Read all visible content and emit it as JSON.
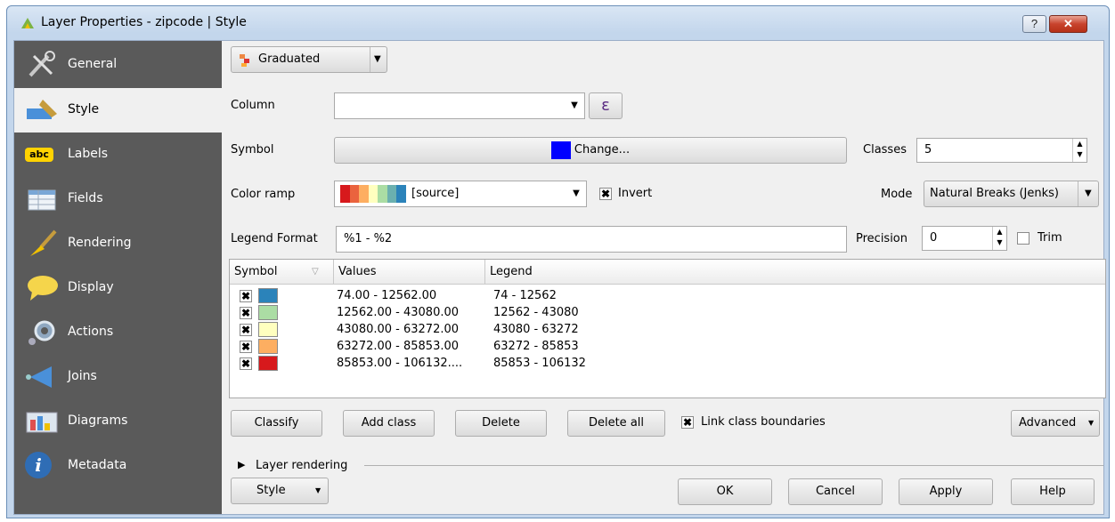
{
  "window": {
    "title": "Layer Properties - zipcode | Style",
    "help_btn": "?",
    "close_btn": "✕"
  },
  "sidebar": {
    "items": [
      {
        "label": "General",
        "icon": "tools-icon"
      },
      {
        "label": "Style",
        "icon": "paintbrush-icon",
        "selected": true
      },
      {
        "label": "Labels",
        "icon": "abc-label-icon",
        "icon_text": "abc"
      },
      {
        "label": "Fields",
        "icon": "table-icon"
      },
      {
        "label": "Rendering",
        "icon": "brush-icon"
      },
      {
        "label": "Display",
        "icon": "speech-bubble-icon"
      },
      {
        "label": "Actions",
        "icon": "gear-icon"
      },
      {
        "label": "Joins",
        "icon": "joins-icon"
      },
      {
        "label": "Diagrams",
        "icon": "diagram-icon"
      },
      {
        "label": "Metadata",
        "icon": "info-icon",
        "icon_text": "i"
      }
    ]
  },
  "renderer": {
    "value": "Graduated"
  },
  "column": {
    "label": "Column",
    "value": "",
    "expression_btn": "ε"
  },
  "symbol": {
    "label": "Symbol",
    "change_btn": "Change...",
    "color": "#0000ff"
  },
  "classes": {
    "label": "Classes",
    "value": "5"
  },
  "color_ramp": {
    "label": "Color ramp",
    "value": "[source]",
    "invert_label": "Invert",
    "invert_checked": true,
    "ramp_colors": [
      "#d7191c",
      "#fdae61",
      "#ffffbf",
      "#abdda4",
      "#2b83ba"
    ]
  },
  "mode": {
    "label": "Mode",
    "value": "Natural Breaks (Jenks)"
  },
  "legend_format": {
    "label": "Legend Format",
    "value": "%1 - %2"
  },
  "precision": {
    "label": "Precision",
    "value": "0",
    "trim_label": "Trim",
    "trim_checked": false
  },
  "table": {
    "headers": [
      "Symbol",
      "Values",
      "Legend"
    ],
    "rows": [
      {
        "color": "#2b83ba",
        "values": "74.00 - 12562.00",
        "legend": "74 - 12562"
      },
      {
        "color": "#abdda4",
        "values": "12562.00 - 43080.00",
        "legend": "12562 - 43080"
      },
      {
        "color": "#ffffbf",
        "values": "43080.00 - 63272.00",
        "legend": "43080 - 63272"
      },
      {
        "color": "#fdae61",
        "values": "63272.00 - 85853.00",
        "legend": "63272 - 85853"
      },
      {
        "color": "#d7191c",
        "values": "85853.00 - 106132....",
        "legend": "85853 - 106132"
      }
    ]
  },
  "actions": {
    "classify": "Classify",
    "add_class": "Add class",
    "delete": "Delete",
    "delete_all": "Delete all",
    "link_label": "Link class boundaries",
    "link_checked": true,
    "advanced": "Advanced"
  },
  "layer_rendering": {
    "label": "Layer rendering"
  },
  "footer": {
    "style": "Style",
    "ok": "OK",
    "cancel": "Cancel",
    "apply": "Apply",
    "help": "Help"
  }
}
